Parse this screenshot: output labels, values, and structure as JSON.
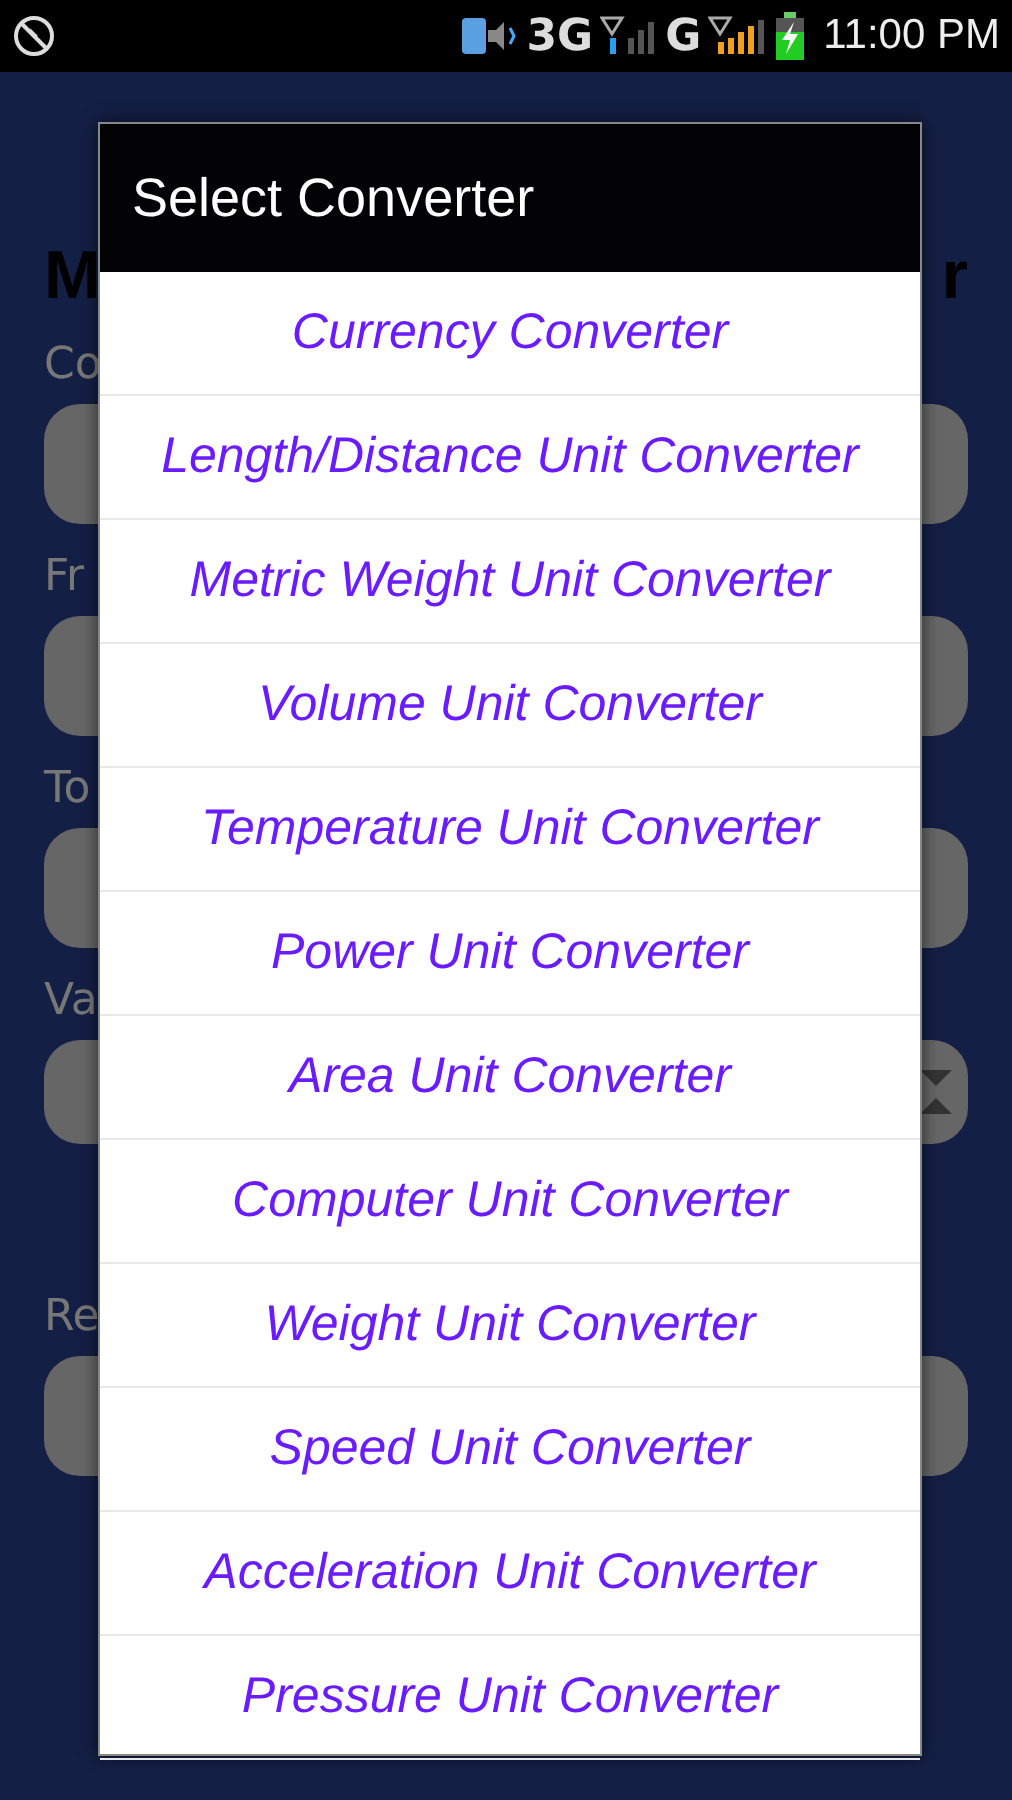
{
  "status_bar": {
    "network_1": "3G",
    "network_2": "G",
    "time": "11:00 PM"
  },
  "background": {
    "title_start": "M",
    "title_end": "r",
    "fields": [
      {
        "label": "Co",
        "kind": "plain"
      },
      {
        "label": "Fr",
        "kind": "plain"
      },
      {
        "label": "To",
        "kind": "plain"
      },
      {
        "label": "Va",
        "kind": "swap"
      },
      {
        "label": "Re",
        "kind": "plain"
      }
    ]
  },
  "dialog": {
    "title": "Select Converter",
    "items": [
      "Currency Converter",
      "Length/Distance Unit Converter",
      "Metric Weight Unit Converter",
      "Volume Unit Converter",
      "Temperature Unit Converter",
      "Power Unit Converter",
      "Area Unit Converter",
      "Computer Unit Converter",
      "Weight Unit Converter",
      "Speed Unit Converter",
      "Acceleration Unit Converter",
      "Pressure Unit Converter"
    ]
  }
}
